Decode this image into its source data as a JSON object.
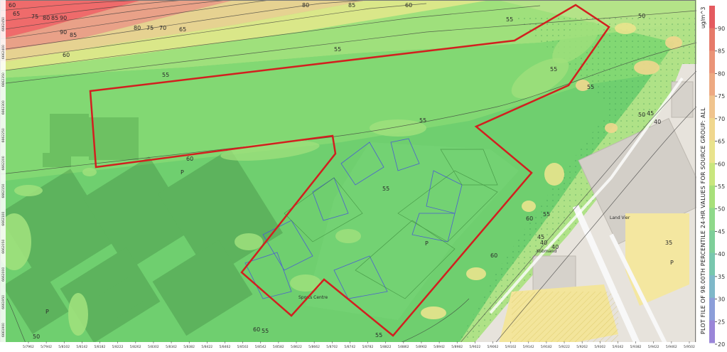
{
  "legend": {
    "title": "PLOT FILE OF 98.00TH PERCENTILE 24-HR VALUES FOR SOURCE GROUP: ALL",
    "unit": "ug/m^3",
    "ticks": [
      "90",
      "85",
      "80",
      "75",
      "70",
      "65",
      "60",
      "55",
      "50",
      "45",
      "40",
      "35",
      "30",
      "25",
      "20"
    ],
    "colors": [
      "#e45b60",
      "#e67a6a",
      "#ea9478",
      "#eda982",
      "#f0c48e",
      "#f0d78e",
      "#e9e38d",
      "#c9e67e",
      "#a8e07a",
      "#8fd98a",
      "#7ecf99",
      "#78c7ae",
      "#7fb8c9",
      "#8c9ed9",
      "#9a86d8"
    ]
  },
  "contour_labels": [
    "65",
    "75",
    "80",
    "85",
    "90",
    "80",
    "75",
    "70",
    "65",
    "60",
    "55",
    "55",
    "90",
    "85",
    "60",
    "80",
    "85",
    "60",
    "55",
    "55",
    "55",
    "60",
    "50",
    "55",
    "40",
    "60",
    "55",
    "50",
    "45",
    "40",
    "60",
    "40",
    "45",
    "35",
    "60",
    "55",
    "50",
    "55",
    "55"
  ],
  "bottom_ticks": [
    "5/7962",
    "5/7942",
    "5/8102",
    "5/8142",
    "5/8182",
    "5/8222",
    "5/8262",
    "5/8302",
    "5/8342",
    "5/8382",
    "5/8422",
    "5/8462",
    "5/8502",
    "5/8542",
    "5/8582",
    "5/8622",
    "5/8662",
    "5/8702",
    "5/8742",
    "5/8782",
    "5/8822",
    "5/8862",
    "5/8902",
    "5/8942",
    "5/8982",
    "5/9022",
    "5/9062",
    "5/9102",
    "5/9142",
    "5/9182",
    "5/9222",
    "5/9262",
    "5/9302",
    "5/9342",
    "5/9382",
    "5/9422",
    "5/9462",
    "5/9502"
  ],
  "left_ticks": [
    "6662450",
    "6662400",
    "6662350",
    "6662300",
    "6662250",
    "6662200",
    "6662150",
    "6662100",
    "6662050",
    "6662000",
    "6661950",
    "6661900"
  ],
  "map_labels": {
    "store": "Kobmand",
    "parking": "P",
    "restaurant": "Land Vier",
    "sports_centre": "Sports Centre"
  }
}
